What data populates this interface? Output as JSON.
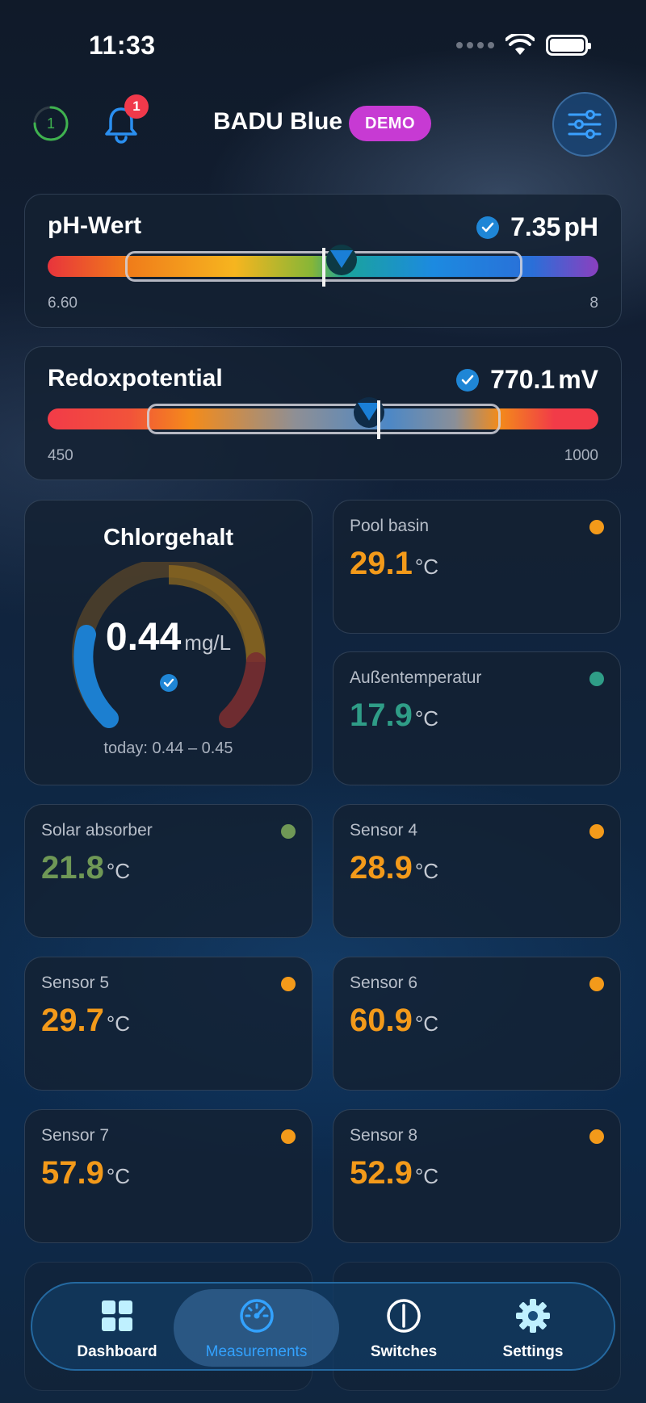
{
  "status_bar": {
    "time": "11:33"
  },
  "header": {
    "progress_count": "1",
    "notification_count": "1",
    "app_name": "BADU Blue",
    "demo_badge": "DEMO"
  },
  "ph": {
    "title": "pH-Wert",
    "value": "7.35",
    "unit": "pH",
    "min": "6.60",
    "max": "8",
    "range_low_fraction": 0.14,
    "range_high_fraction": 0.86,
    "marker_fraction": 0.5
  },
  "redox": {
    "title": "Redoxpotential",
    "value": "770.1",
    "unit": "mV",
    "min": "450",
    "max": "1000",
    "range_low_fraction": 0.18,
    "range_high_fraction": 0.82,
    "marker_fraction": 0.6
  },
  "chlorine": {
    "title": "Chlorgehalt",
    "value": "0.44",
    "unit": "mg/L",
    "today_range": "today: 0.44 – 0.45",
    "gauge_fraction": 0.2
  },
  "tiles": [
    {
      "label": "Pool basin",
      "value": "29.1",
      "unit": "°C",
      "color": "#f39a1a"
    },
    {
      "label": "Außentemperatur",
      "value": "17.9",
      "unit": "°C",
      "color": "#2f9d87"
    },
    {
      "label": "Solar absorber",
      "value": "21.8",
      "unit": "°C",
      "color": "#6f9856"
    },
    {
      "label": "Sensor 4",
      "value": "28.9",
      "unit": "°C",
      "color": "#f39a1a"
    },
    {
      "label": "Sensor 5",
      "value": "29.7",
      "unit": "°C",
      "color": "#f39a1a"
    },
    {
      "label": "Sensor 6",
      "value": "60.9",
      "unit": "°C",
      "color": "#f39a1a"
    },
    {
      "label": "Sensor 7",
      "value": "57.9",
      "unit": "°C",
      "color": "#f39a1a"
    },
    {
      "label": "Sensor 8",
      "value": "52.9",
      "unit": "°C",
      "color": "#f39a1a"
    }
  ],
  "nav": {
    "dashboard": "Dashboard",
    "measurements": "Measurements",
    "switches": "Switches",
    "settings": "Settings"
  }
}
